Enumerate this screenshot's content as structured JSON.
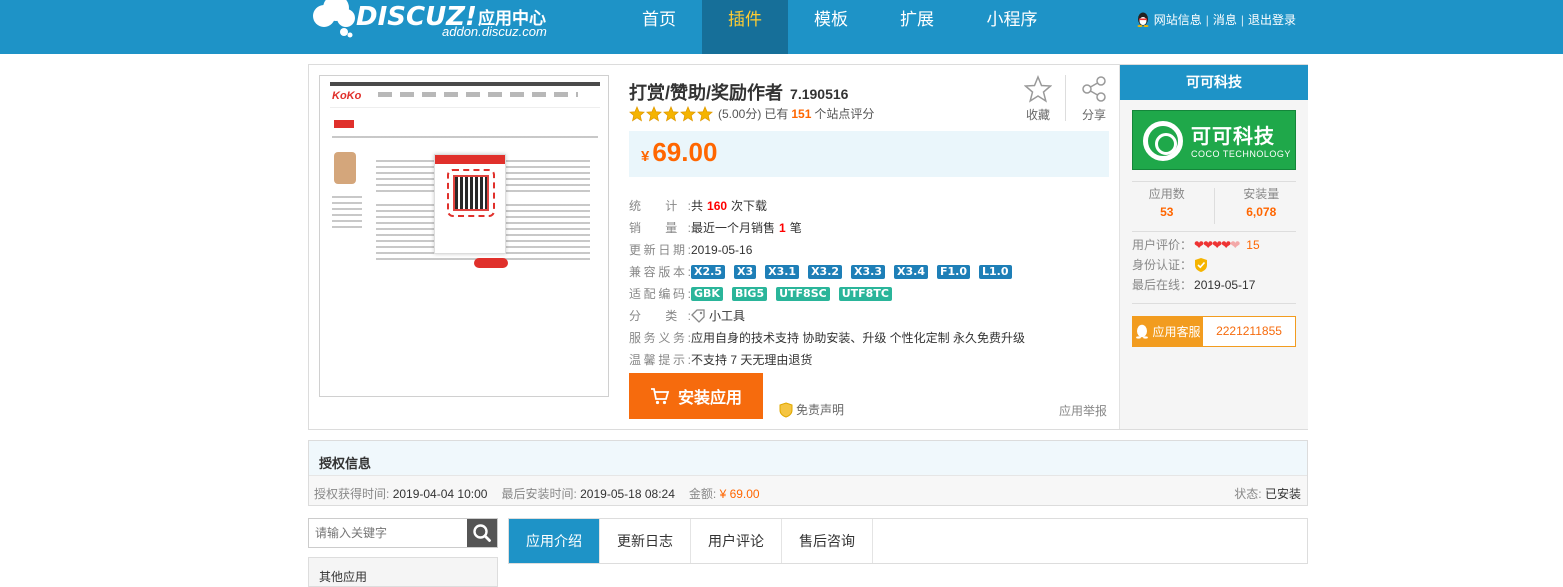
{
  "header": {
    "brand": "DISCUZ!",
    "brand_sub": "应用中心",
    "domain": "addon.discuz.com",
    "nav": [
      {
        "label": "首页"
      },
      {
        "label": "插件"
      },
      {
        "label": "模板"
      },
      {
        "label": "扩展"
      },
      {
        "label": "小程序"
      }
    ],
    "user_links": {
      "site_info": "网站信息",
      "sep": "|",
      "messages": "消息",
      "logout": "退出登录"
    }
  },
  "product": {
    "title": "打赏/赞助/奖励作者",
    "version": "7.190516",
    "rating_score": "(5.00分)",
    "rating_prefix": "已有",
    "rating_count": "151",
    "rating_suffix": "个站点评分",
    "stars": 5,
    "favorite_label": "收藏",
    "share_label": "分享",
    "price_symbol": "¥",
    "price": "69.00",
    "info": {
      "downloads_key": "统  计:",
      "downloads_pre": "共",
      "downloads_num": "160",
      "downloads_post": "次下载",
      "sales_key": "销  量:",
      "sales_pre": "最近一个月销售",
      "sales_num": "1",
      "sales_post": "笔",
      "updated_key": "更新日期:",
      "updated_val": "2019-05-16",
      "compat_key": "兼容版本:",
      "compat": [
        "X2.5",
        "X3",
        "X3.1",
        "X3.2",
        "X3.3",
        "X3.4",
        "F1.0",
        "L1.0"
      ],
      "encoding_key": "适配编码:",
      "encoding": [
        "GBK",
        "BIG5",
        "UTF8SC",
        "UTF8TC"
      ],
      "category_key": "分  类:",
      "category_val": "小工具",
      "service_key": "服务义务:",
      "service_val": "应用自身的技术支持  协助安装、升级  个性化定制  永久免费升级",
      "tip_key": "温馨提示:",
      "tip_val": "不支持 7 天无理由退货"
    },
    "install_label": "安装应用",
    "disclaimer_label": "免责声明",
    "report_label": "应用举报"
  },
  "developer": {
    "name": "可可科技",
    "logo_cn": "可可科技",
    "logo_en": "COCO TECHNOLOGY",
    "apps_label": "应用数",
    "apps_count": "53",
    "installs_label": "安装量",
    "installs_count": "6,078",
    "rating_label": "用户评价：",
    "rating_count": "15",
    "verify_label": "身份认证：",
    "last_online_label": "最后在线：",
    "last_online": "2019-05-17",
    "service_label": "应用客服",
    "service_qq": "2221211855"
  },
  "license": {
    "title": "授权信息",
    "obtained_label": "授权获得时间:",
    "obtained": "2019-04-04 10:00",
    "last_install_label": "最后安装时间:",
    "last_install": "2019-05-18 08:24",
    "amount_label": "金额:",
    "amount": "¥ 69.00",
    "state_label": "状态:",
    "state": "已安装"
  },
  "search": {
    "placeholder": "请输入关键字"
  },
  "other_apps_label": "其他应用",
  "tabs": [
    {
      "label": "应用介绍"
    },
    {
      "label": "更新日志"
    },
    {
      "label": "用户评论"
    },
    {
      "label": "售后咨询"
    }
  ],
  "colors": {
    "brand_blue": "#1e93c7",
    "active_nav": "#166f99",
    "accent_orange": "#f60",
    "install_orange": "#f66b0d",
    "dev_green": "#1fa84a"
  }
}
